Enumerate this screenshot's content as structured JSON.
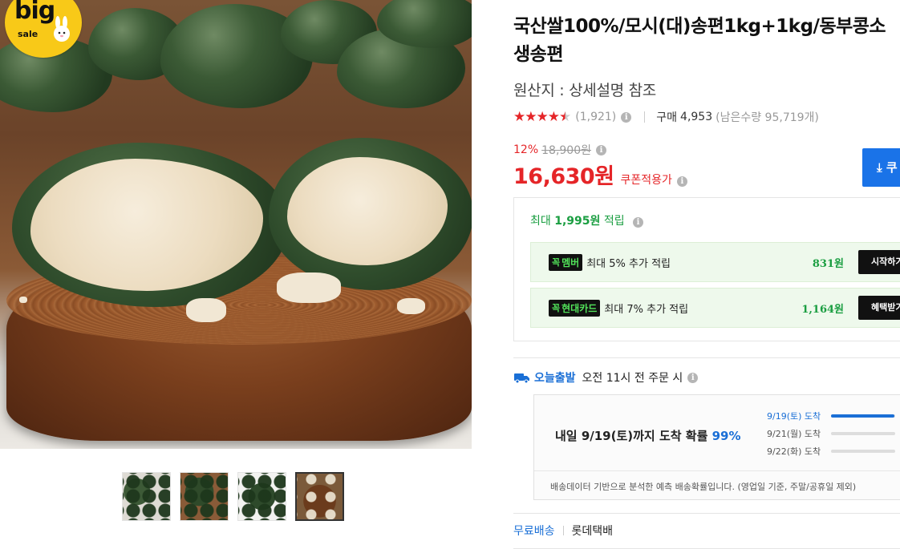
{
  "badge": {
    "big": "big",
    "sale": "sale"
  },
  "product": {
    "title": "국산쌀100%/모시(대)송편1kg+1kg/동부콩소 생송편",
    "origin": "원산지 : 상세설명 참조"
  },
  "rating": {
    "stars_value": 4.5,
    "review_count": "(1,921)",
    "purchase_label": "구매",
    "purchase_count": "4,953",
    "remaining": "(남은수량 95,719개)"
  },
  "price": {
    "discount_rate": "12%",
    "original_price": "18,900원",
    "sale_price": "16,630원",
    "coupon_text": "쿠폰적용가"
  },
  "coupon_button": {
    "label": "⤓ 쿠"
  },
  "points": {
    "header_prefix": "최대",
    "header_amount": "1,995원",
    "header_suffix": "적립",
    "benefits": [
      {
        "tag": "멤버",
        "tag_prefix": "꼭",
        "desc": "최대 5% 추가 적립",
        "amount": "831원",
        "button": "시작하기"
      },
      {
        "tag": "현대카드",
        "tag_prefix": "꼭",
        "desc": "최대 7% 추가 적립",
        "amount": "1,164원",
        "button": "혜택받기"
      }
    ]
  },
  "delivery": {
    "today_label": "오늘출발",
    "today_desc": "오전 11시 전 주문 시",
    "main_text": "내일 9/19(토)까지 도착 확률",
    "main_pct": "99%",
    "probabilities": [
      {
        "label": "9/19(토) 도착",
        "value": 0.99
      },
      {
        "label": "9/21(월) 도착",
        "value": 0.0
      },
      {
        "label": "9/22(화) 도착",
        "value": 0.0
      }
    ],
    "note": "배송데이터 기반으로 분석한 예측 배송확률입니다. (영업일 기준, 주말/공휴일 제외)"
  },
  "shipping": {
    "free": "무료배송",
    "carrier": "롯데택배"
  },
  "colors": {
    "accent_red": "#e52528",
    "accent_blue": "#1a6fd6",
    "point_green": "#1a9e41",
    "badge_yellow": "#f8c918"
  },
  "icons": [
    "info-icon",
    "truck-icon",
    "download-icon",
    "star-icon"
  ]
}
